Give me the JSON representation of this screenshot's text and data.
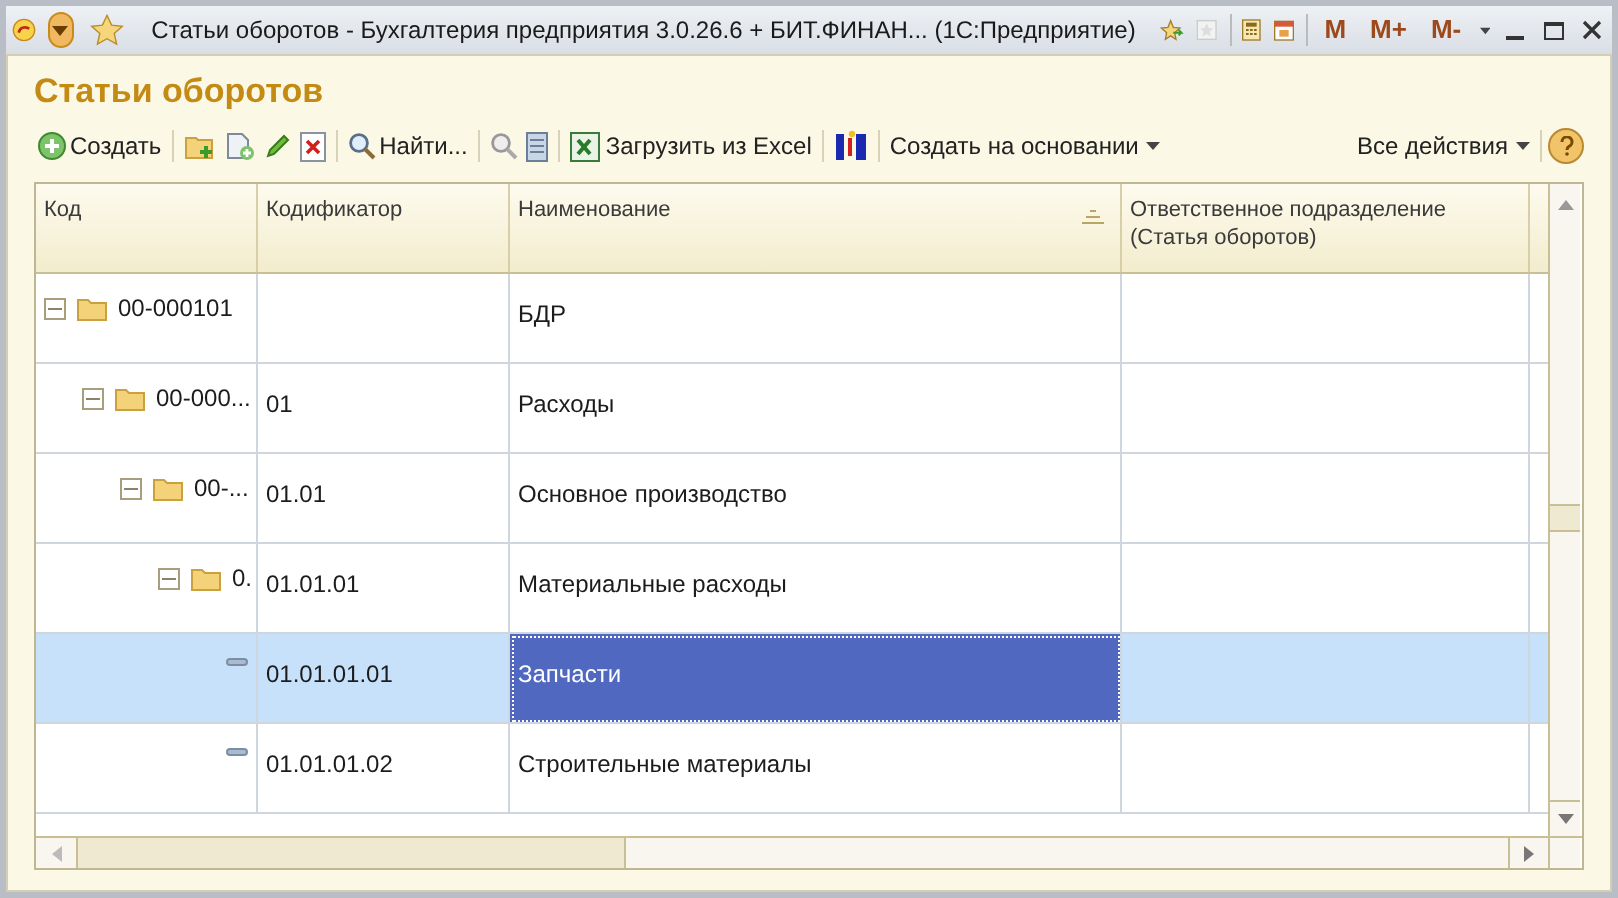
{
  "window": {
    "title": "Статьи оборотов - Бухгалтерия предприятия 3.0.26.6 + БИТ.ФИНАН...  (1С:Предприятие)",
    "memory_buttons": [
      "M",
      "M+",
      "M-"
    ]
  },
  "form": {
    "title": "Статьи оборотов"
  },
  "toolbar": {
    "create": "Создать",
    "find": "Найти...",
    "load_excel": "Загрузить из Excel",
    "create_based": "Создать на основании",
    "all_actions": "Все действия"
  },
  "table": {
    "columns": [
      "Код",
      "Кодификатор",
      "Наименование",
      "Ответственное подразделение (Статья оборотов)"
    ],
    "rows": [
      {
        "kind": "group",
        "code": "00-000101",
        "codifier": "",
        "name": "БДР",
        "expanded": true,
        "selected": false,
        "children": [
          {
            "kind": "group",
            "code": "00-000...",
            "codifier": "01",
            "name": "Расходы",
            "expanded": true,
            "selected": false,
            "children": [
              {
                "kind": "group",
                "code": "00-...",
                "codifier": "01.01",
                "name": "Основное производство",
                "expanded": true,
                "selected": false,
                "children": [
                  {
                    "kind": "group",
                    "code": "0.",
                    "codifier": "01.01.01",
                    "name": "Материальные расходы",
                    "expanded": true,
                    "selected": false,
                    "children": [
                      {
                        "kind": "item",
                        "codifier": "01.01.01.01",
                        "name": "Запчасти",
                        "selected": true
                      },
                      {
                        "kind": "item",
                        "codifier": "01.01.01.02",
                        "name": "Строительные материалы",
                        "selected": false
                      }
                    ]
                  }
                ]
              }
            ]
          }
        ]
      }
    ]
  }
}
